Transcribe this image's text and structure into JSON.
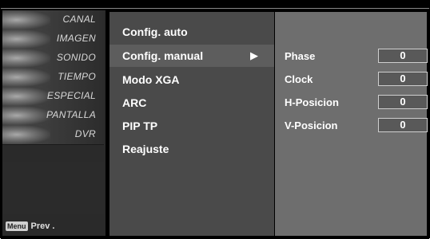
{
  "sidebar": {
    "items": [
      {
        "label": "CANAL",
        "icon": "channel-thumbnail-icon"
      },
      {
        "label": "IMAGEN",
        "icon": "picture-thumbnail-icon"
      },
      {
        "label": "SONIDO",
        "icon": "sound-thumbnail-icon"
      },
      {
        "label": "TIEMPO",
        "icon": "clock-thumbnail-icon"
      },
      {
        "label": "ESPECIAL",
        "icon": "special-thumbnail-icon"
      },
      {
        "label": "PANTALLA",
        "icon": "screen-thumbnail-icon"
      },
      {
        "label": "DVR",
        "icon": "disc-thumbnail-icon"
      }
    ],
    "footer": {
      "menu_key": "Menu",
      "prev_label": "Prev ."
    }
  },
  "menu": {
    "items": [
      {
        "label": "Config. auto"
      },
      {
        "label": "Config. manual",
        "selected": true
      },
      {
        "label": "Modo XGA"
      },
      {
        "label": "ARC"
      },
      {
        "label": "PIP TP"
      },
      {
        "label": "Reajuste"
      }
    ],
    "arrow": "▶"
  },
  "submenu": {
    "rows": [
      {
        "label": "Phase",
        "value": "0"
      },
      {
        "label": "Clock",
        "value": "0"
      },
      {
        "label": "H-Posicion",
        "value": "0"
      },
      {
        "label": "V-Posicion",
        "value": "0"
      }
    ]
  },
  "colors": {
    "background": "#000000",
    "menu_panel": "#4a4a4a",
    "submenu_panel": "#6e6e6e",
    "value_box": "#595959"
  }
}
